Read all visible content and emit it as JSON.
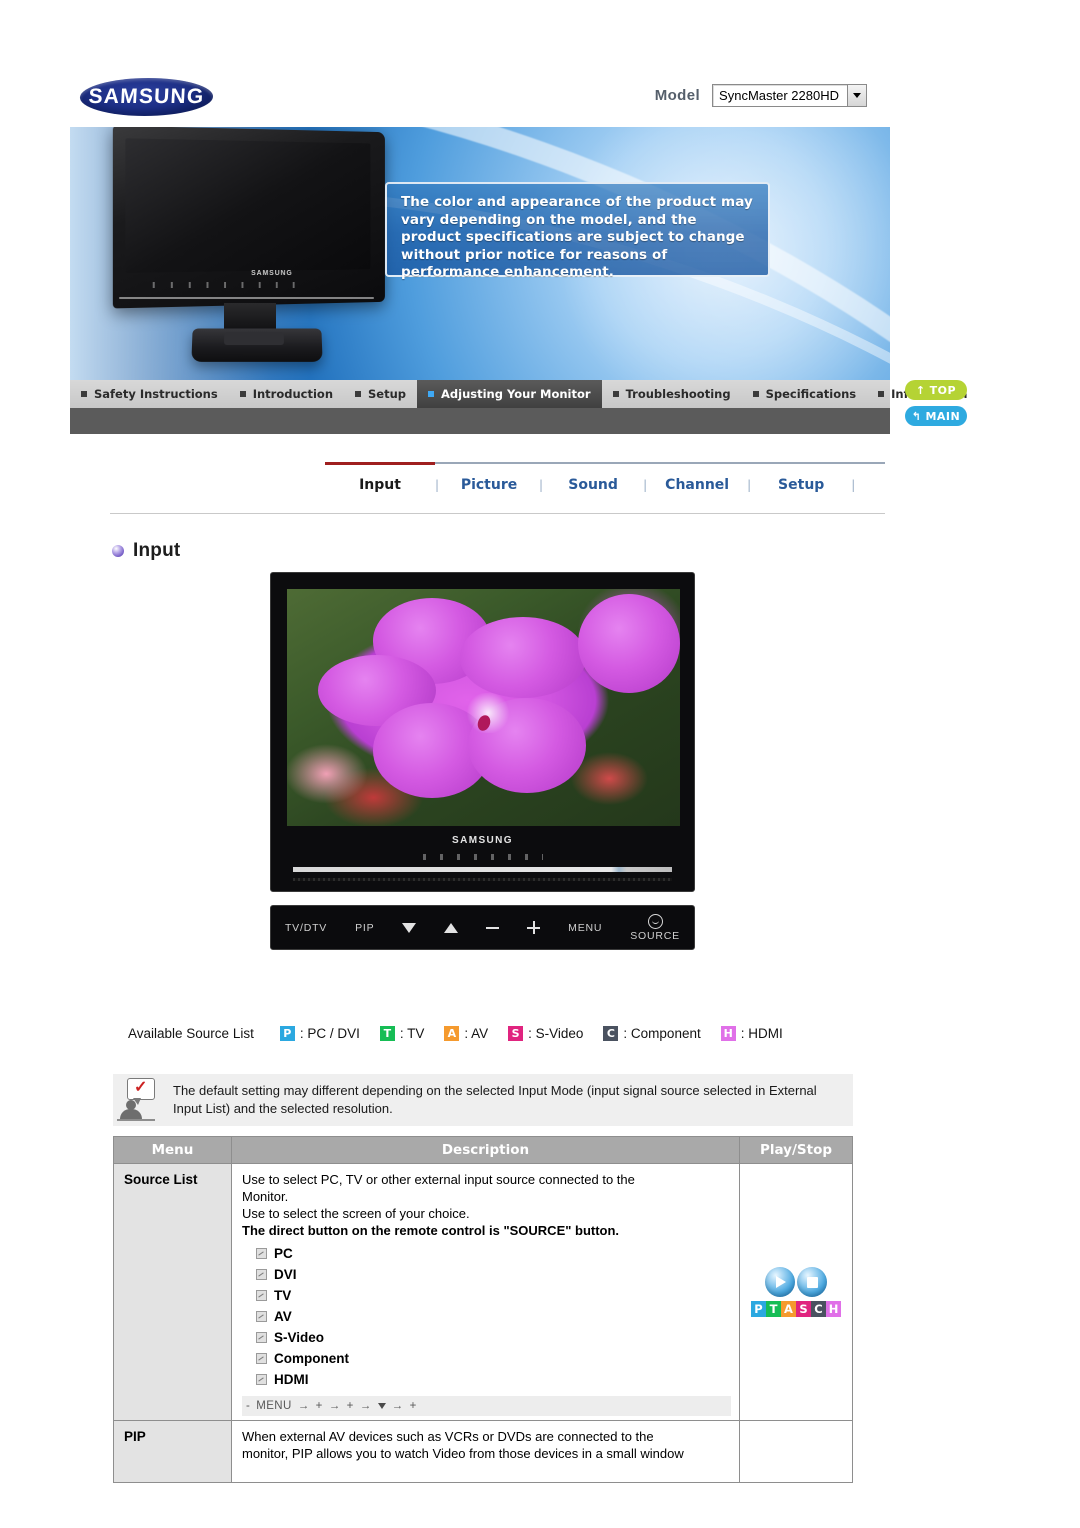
{
  "header": {
    "logo_text": "SAMSUNG",
    "model_label": "Model",
    "model_value": "SyncMaster 2280HD"
  },
  "banner": {
    "callout_text": "The color and appearance of the product may vary depending on the model, and the product specifications are subject to change without prior notice for reasons of performance enhancement.",
    "monitor_brand": "SAMSUNG"
  },
  "nav": {
    "items": [
      {
        "label": "Safety Instructions",
        "active": false
      },
      {
        "label": "Introduction",
        "active": false
      },
      {
        "label": "Setup",
        "active": false
      },
      {
        "label": "Adjusting Your Monitor",
        "active": true
      },
      {
        "label": "Troubleshooting",
        "active": false
      },
      {
        "label": "Specifications",
        "active": false
      },
      {
        "label": "Information",
        "active": false
      }
    ],
    "top_button": "TOP",
    "main_button": "MAIN"
  },
  "subtabs": {
    "items": [
      "Input",
      "Picture",
      "Sound",
      "Channel",
      "Setup"
    ],
    "active": "Input",
    "separator": "|"
  },
  "section": {
    "title": "Input"
  },
  "monitor_photo": {
    "brand": "SAMSUNG",
    "controls": [
      "TV/DTV",
      "PIP",
      "▼",
      "▲",
      "−",
      "+",
      "MENU",
      "SOURCE"
    ]
  },
  "legend": {
    "label": "Available Source List",
    "items": [
      {
        "code": "P",
        "text": ": PC / DVI",
        "color": "#2ba8e0"
      },
      {
        "code": "T",
        "text": ": TV",
        "color": "#16bd55"
      },
      {
        "code": "A",
        "text": ": AV",
        "color": "#f59a2e"
      },
      {
        "code": "S",
        "text": ": S-Video",
        "color": "#e0247f"
      },
      {
        "code": "C",
        "text": ": Component",
        "color": "#4a5260"
      },
      {
        "code": "H",
        "text": ": HDMI",
        "color": "#e070e8"
      }
    ]
  },
  "note": {
    "text": "The default setting may different depending on the selected Input Mode (input signal source selected in External Input List) and the selected resolution."
  },
  "table": {
    "headers": [
      "Menu",
      "Description",
      "Play/Stop"
    ],
    "rows": [
      {
        "menu": "Source List",
        "lines": [
          {
            "text": "Use to select PC, TV or other external input source connected to the",
            "bold": false
          },
          {
            "text": "Monitor.",
            "bold": false
          },
          {
            "text": "Use to select the screen of your choice.",
            "bold": false
          },
          {
            "text": "The direct button on the remote control is \"SOURCE\" button.",
            "bold": true
          }
        ],
        "options": [
          "PC",
          "DVI",
          "TV",
          "AV",
          "S-Video",
          "Component",
          "HDMI"
        ],
        "menu_path": [
          "MENU",
          "→",
          "+",
          "→",
          "+",
          "→",
          "▼",
          "→",
          "+"
        ],
        "play_badges": [
          {
            "code": "P",
            "color": "#2ba8e0"
          },
          {
            "code": "T",
            "color": "#16bd55"
          },
          {
            "code": "A",
            "color": "#f59a2e"
          },
          {
            "code": "S",
            "color": "#e0247f"
          },
          {
            "code": "C",
            "color": "#4a5260"
          },
          {
            "code": "H",
            "color": "#e070e8"
          }
        ]
      },
      {
        "menu": "PIP",
        "lines": [
          {
            "text": "When external AV devices such as VCRs or DVDs are connected to the",
            "bold": false
          },
          {
            "text": "monitor, PIP allows you to watch Video from those devices in a small window",
            "bold": false
          }
        ],
        "options": [],
        "menu_path": [],
        "play_badges": []
      }
    ]
  }
}
